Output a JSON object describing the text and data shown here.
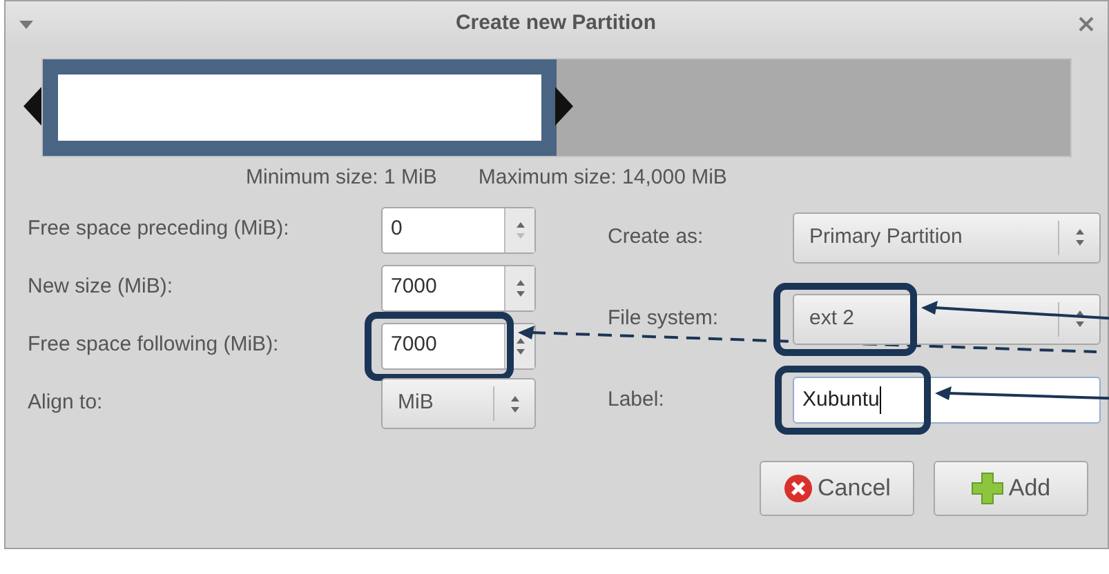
{
  "window": {
    "title": "Create new Partition"
  },
  "partition_bar": {
    "level": 0.5
  },
  "min_size": "Minimum size: 1 MiB",
  "max_size": "Maximum size: 14,000 MiB",
  "left_fields": [
    {
      "kind": "spin",
      "label": "Free space preceding (MiB):",
      "value": "0",
      "highlighted": false
    },
    {
      "kind": "spin",
      "label": "New size (MiB):",
      "value": "7000",
      "highlighted": false
    },
    {
      "kind": "spin",
      "label": "Free space following (MiB):",
      "value": "7000",
      "highlighted": true,
      "dashed_arrow": true
    },
    {
      "kind": "combo",
      "label": "Align to:",
      "value": "MiB",
      "highlighted": false
    }
  ],
  "right_fields": [
    {
      "kind": "combo",
      "label": "Create as:",
      "value": "Primary Partition",
      "highlighted": false
    },
    {
      "kind": "combo",
      "label": "File system:",
      "value": "ext 2",
      "highlighted": true,
      "dashed_arrow": false
    },
    {
      "kind": "entry",
      "label": "Label:",
      "value": "Xubuntu",
      "highlighted": true,
      "dashed_arrow": false
    }
  ],
  "buttons": [
    {
      "kind": "cancel",
      "label": "Cancel"
    },
    {
      "kind": "add",
      "label": "Add"
    }
  ]
}
